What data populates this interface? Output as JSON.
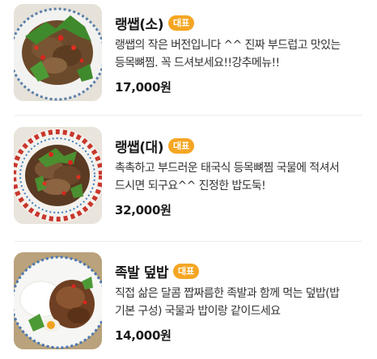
{
  "menu": {
    "items": [
      {
        "name": "랭쌥(소)",
        "badge": "대표",
        "description": "랭쌥의 작은 버전입니다 ^^ 진짜 부드럽고 맛있는\n등목뼈찜. 꼭 드셔보세요!!강추메뉴!!",
        "price": "17,000원",
        "image_icon": "braised-pork-spine-dish"
      },
      {
        "name": "랭쌥(대)",
        "badge": "대표",
        "description": "촉촉하고 부드러운 태국식 등목뼈찜 국물에 적셔서\n드시면 되구요^^ 진정한 밥도둑!",
        "price": "32,000원",
        "image_icon": "large-pork-spine-plate"
      },
      {
        "name": "족발 덮밥",
        "badge": "대표",
        "description": "직접 삶은 달콤 짭짜름한 족발과 함께 먹는 덮밥(밥\n기본 구성) 국물과 밥이랑 같이드세요",
        "price": "14,000원",
        "image_icon": "pork-trotter-rice-plate"
      }
    ]
  },
  "colors": {
    "badge": "#f5a623",
    "divider": "#ececec",
    "text_primary": "#1a1a1a",
    "text_secondary": "#333333"
  }
}
